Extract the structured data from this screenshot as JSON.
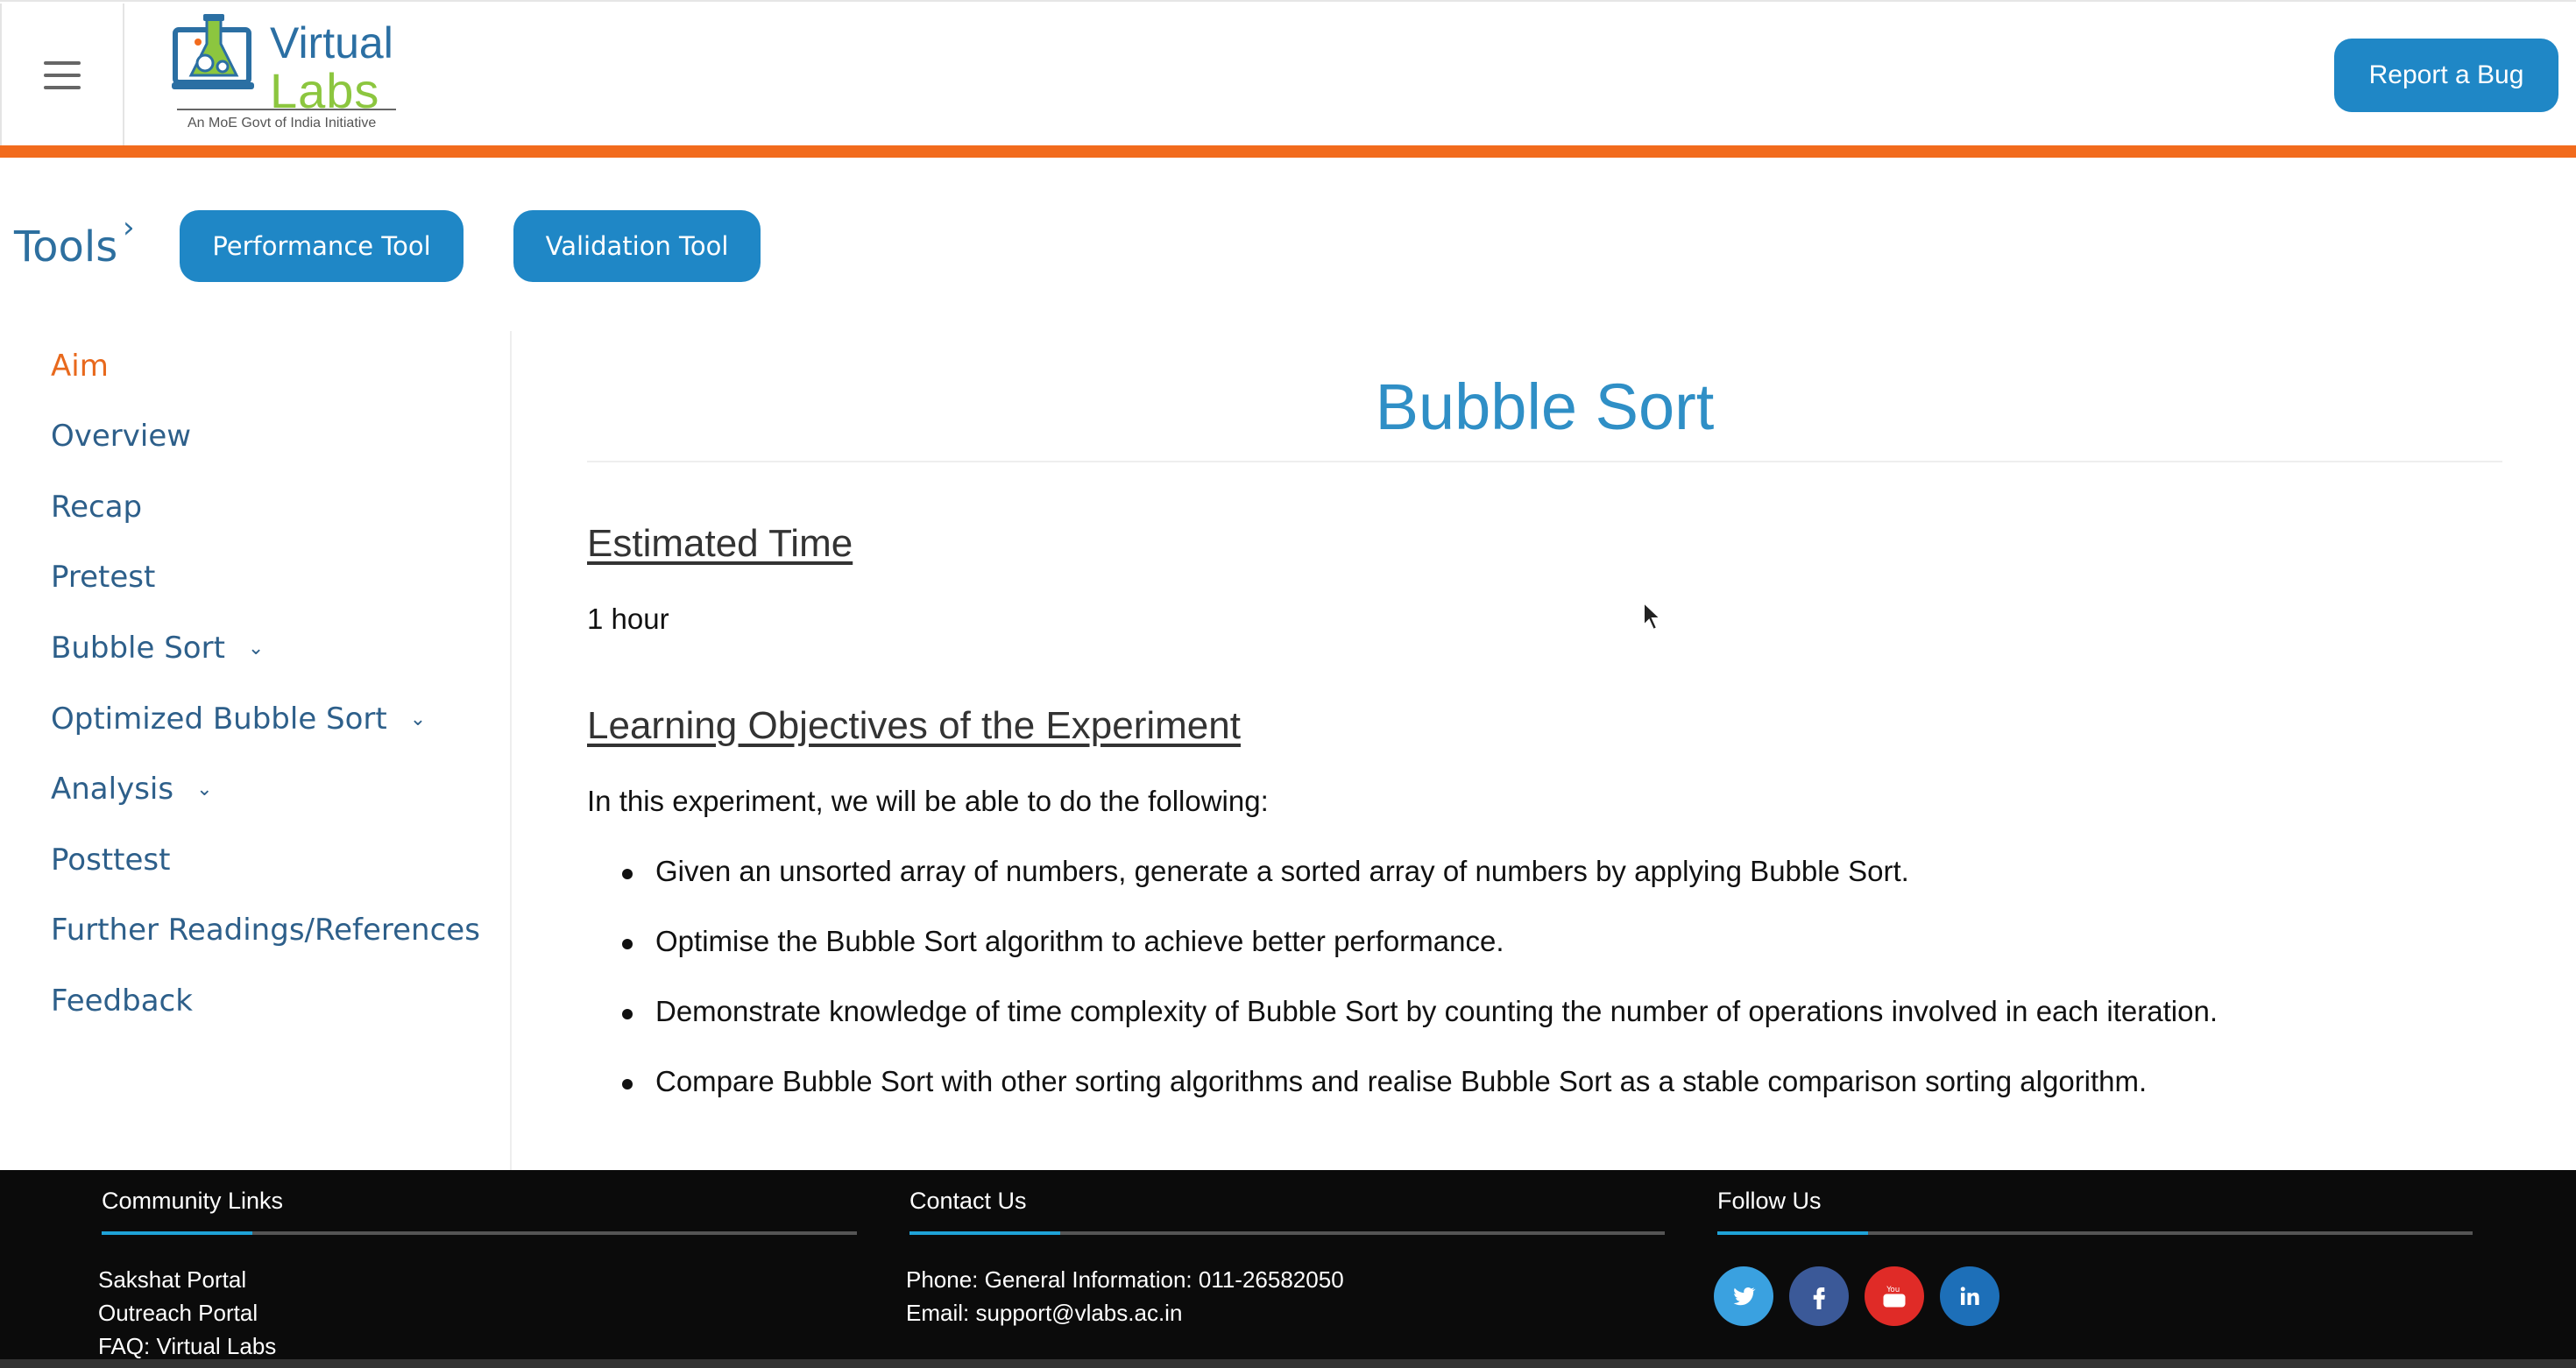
{
  "header": {
    "logo_line1": "Virtual",
    "logo_line2": "Labs",
    "logo_tagline": "An MoE Govt of India Initiative",
    "report_bug_label": "Report a Bug"
  },
  "tools": {
    "title": "Tools",
    "buttons": [
      "Performance Tool",
      "Validation Tool"
    ]
  },
  "sidebar": {
    "items": [
      {
        "label": "Aim",
        "active": true,
        "expandable": false
      },
      {
        "label": "Overview",
        "active": false,
        "expandable": false
      },
      {
        "label": "Recap",
        "active": false,
        "expandable": false
      },
      {
        "label": "Pretest",
        "active": false,
        "expandable": false
      },
      {
        "label": "Bubble Sort",
        "active": false,
        "expandable": true
      },
      {
        "label": "Optimized Bubble Sort",
        "active": false,
        "expandable": true
      },
      {
        "label": "Analysis",
        "active": false,
        "expandable": true
      },
      {
        "label": "Posttest",
        "active": false,
        "expandable": false
      },
      {
        "label": "Further Readings/References",
        "active": false,
        "expandable": false
      },
      {
        "label": "Feedback",
        "active": false,
        "expandable": false
      }
    ]
  },
  "main": {
    "title": "Bubble Sort",
    "estimated_time_heading": "Estimated Time",
    "estimated_time_value": "1 hour",
    "objectives_heading": "Learning Objectives of the Experiment",
    "objectives_intro": "In this experiment, we will be able to do the following:",
    "objectives": [
      "Given an unsorted array of numbers, generate a sorted array of numbers by applying Bubble Sort.",
      "Optimise the Bubble Sort algorithm to achieve better performance.",
      "Demonstrate knowledge of time complexity of Bubble Sort by counting the number of operations involved in each iteration.",
      "Compare Bubble Sort with other sorting algorithms and realise Bubble Sort as a stable comparison sorting algorithm."
    ]
  },
  "footer": {
    "community": {
      "heading": "Community Links",
      "links": [
        "Sakshat Portal",
        "Outreach Portal",
        "FAQ: Virtual Labs"
      ]
    },
    "contact": {
      "heading": "Contact Us",
      "phone": "Phone: General Information: 011-26582050",
      "email": "Email: support@vlabs.ac.in"
    },
    "follow": {
      "heading": "Follow Us",
      "icons": [
        {
          "name": "twitter-icon",
          "color": "#3aa1e0"
        },
        {
          "name": "facebook-icon",
          "color": "#3b5998"
        },
        {
          "name": "youtube-icon",
          "color": "#e02b27"
        },
        {
          "name": "linkedin-icon",
          "color": "#1d6fb8"
        }
      ]
    }
  },
  "colors": {
    "accent_orange": "#f26b1d",
    "primary_blue": "#1f87c6",
    "title_blue": "#2f8fc6",
    "nav_blue": "#2d5f8a"
  }
}
